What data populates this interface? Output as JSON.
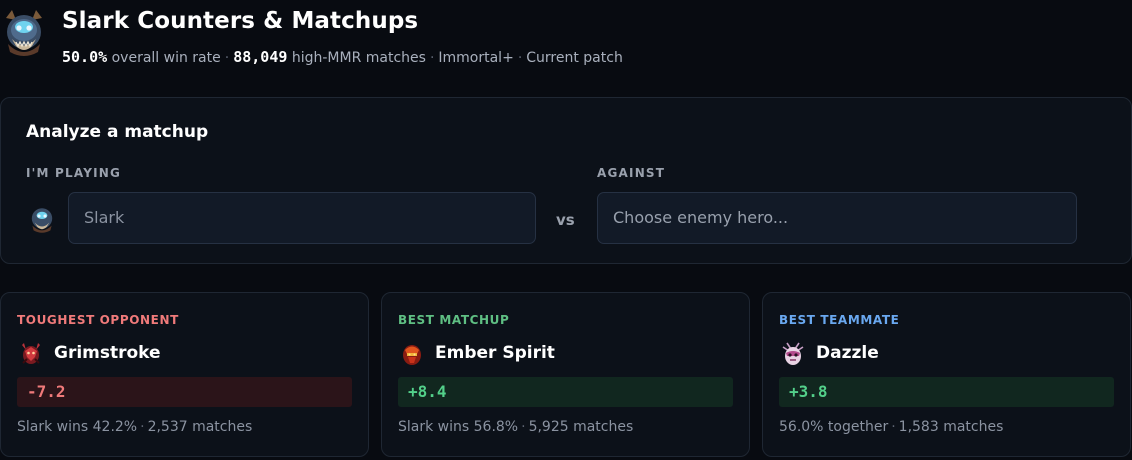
{
  "header": {
    "title": "Slark Counters & Matchups",
    "win_rate": "50.0%",
    "win_rate_label": "overall win rate",
    "match_count": "88,049",
    "match_label": "high-MMR matches",
    "bracket": "Immortal+",
    "patch": "Current patch",
    "hero_icon": "slark-portrait-icon"
  },
  "analyze": {
    "title": "Analyze a matchup",
    "playing_label": "I'M PLAYING",
    "playing_value": "Slark",
    "vs_label": "vs",
    "against_label": "AGAINST",
    "against_placeholder": "Choose enemy hero..."
  },
  "cards": [
    {
      "label": "TOUGHEST OPPONENT",
      "hero": "Grimstroke",
      "delta": "-7.2",
      "foot_a": "Slark wins 42.2%",
      "foot_b": "2,537 matches",
      "accent": "#f07a7a",
      "bar_bg": "#2b1419",
      "delta_color": "#f07a7a"
    },
    {
      "label": "BEST MATCHUP",
      "hero": "Ember Spirit",
      "delta": "+8.4",
      "foot_a": "Slark wins 56.8%",
      "foot_b": "5,925 matches",
      "accent": "#5fbf83",
      "bar_bg": "#11271f",
      "delta_color": "#53d08a"
    },
    {
      "label": "BEST TEAMMATE",
      "hero": "Dazzle",
      "delta": "+3.8",
      "foot_a": "56.0% together",
      "foot_b": "1,583 matches",
      "accent": "#6aa8f0",
      "bar_bg": "#11271f",
      "delta_color": "#53d08a"
    }
  ]
}
